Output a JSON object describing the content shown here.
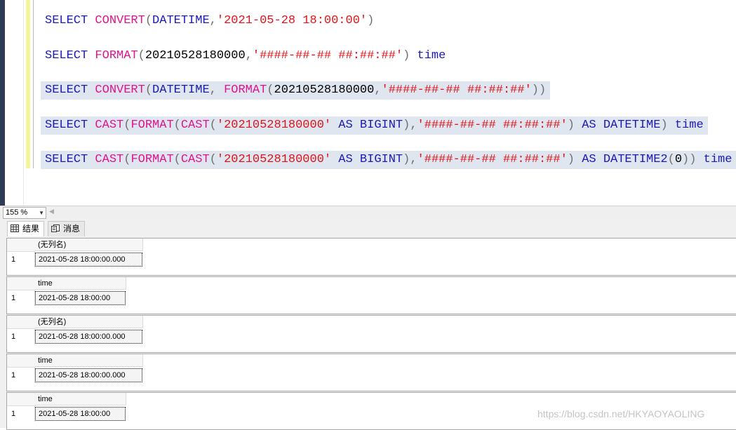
{
  "editor": {
    "lines": [
      [
        {
          "t": "SELECT ",
          "c": "kw"
        },
        {
          "t": "CONVERT",
          "c": "fn"
        },
        {
          "t": "(",
          "c": "pn"
        },
        {
          "t": "DATETIME",
          "c": "kw"
        },
        {
          "t": ",",
          "c": "pn"
        },
        {
          "t": "'2021-05-28 18:00:00'",
          "c": "str"
        },
        {
          "t": ")",
          "c": "pn"
        }
      ],
      [
        {
          "t": "SELECT ",
          "c": "kw"
        },
        {
          "t": "FORMAT",
          "c": "fn"
        },
        {
          "t": "(",
          "c": "pn"
        },
        {
          "t": "20210528180000",
          "c": "tx"
        },
        {
          "t": ",",
          "c": "pn"
        },
        {
          "t": "'####-##-## ##:##:##'",
          "c": "str"
        },
        {
          "t": ") ",
          "c": "pn"
        },
        {
          "t": "time",
          "c": "kw"
        }
      ],
      [
        {
          "t": "SELECT ",
          "c": "kw"
        },
        {
          "t": "CONVERT",
          "c": "fn"
        },
        {
          "t": "(",
          "c": "pn"
        },
        {
          "t": "DATETIME",
          "c": "kw"
        },
        {
          "t": ", ",
          "c": "pn"
        },
        {
          "t": "FORMAT",
          "c": "fn"
        },
        {
          "t": "(",
          "c": "pn"
        },
        {
          "t": "20210528180000",
          "c": "tx"
        },
        {
          "t": ",",
          "c": "pn"
        },
        {
          "t": "'####-##-## ##:##:##'",
          "c": "str"
        },
        {
          "t": "))",
          "c": "pn"
        }
      ],
      [
        {
          "t": "SELECT ",
          "c": "kw"
        },
        {
          "t": "CAST",
          "c": "fn"
        },
        {
          "t": "(",
          "c": "pn"
        },
        {
          "t": "FORMAT",
          "c": "fn"
        },
        {
          "t": "(",
          "c": "pn"
        },
        {
          "t": "CAST",
          "c": "fn"
        },
        {
          "t": "(",
          "c": "pn"
        },
        {
          "t": "'20210528180000'",
          "c": "str"
        },
        {
          "t": " AS ",
          "c": "kw"
        },
        {
          "t": "BIGINT",
          "c": "kw"
        },
        {
          "t": "),",
          "c": "pn"
        },
        {
          "t": "'####-##-## ##:##:##'",
          "c": "str"
        },
        {
          "t": ") ",
          "c": "pn"
        },
        {
          "t": "AS ",
          "c": "kw"
        },
        {
          "t": "DATETIME",
          "c": "kw"
        },
        {
          "t": ") ",
          "c": "pn"
        },
        {
          "t": "time",
          "c": "kw"
        }
      ],
      [
        {
          "t": "SELECT ",
          "c": "kw"
        },
        {
          "t": "CAST",
          "c": "fn"
        },
        {
          "t": "(",
          "c": "pn"
        },
        {
          "t": "FORMAT",
          "c": "fn"
        },
        {
          "t": "(",
          "c": "pn"
        },
        {
          "t": "CAST",
          "c": "fn"
        },
        {
          "t": "(",
          "c": "pn"
        },
        {
          "t": "'20210528180000'",
          "c": "str"
        },
        {
          "t": " AS ",
          "c": "kw"
        },
        {
          "t": "BIGINT",
          "c": "kw"
        },
        {
          "t": "),",
          "c": "pn"
        },
        {
          "t": "'####-##-## ##:##:##'",
          "c": "str"
        },
        {
          "t": ") ",
          "c": "pn"
        },
        {
          "t": "AS ",
          "c": "kw"
        },
        {
          "t": "DATETIME2",
          "c": "kw"
        },
        {
          "t": "(",
          "c": "pn"
        },
        {
          "t": "0",
          "c": "tx"
        },
        {
          "t": ")) ",
          "c": "pn"
        },
        {
          "t": "time",
          "c": "kw"
        }
      ]
    ],
    "selected_lines": [
      2,
      3,
      4
    ]
  },
  "zoom": {
    "value": "155 %"
  },
  "tabs": [
    {
      "label": "结果",
      "icon": "grid-icon",
      "active": true
    },
    {
      "label": "消息",
      "icon": "message-icon",
      "active": false
    }
  ],
  "results": [
    {
      "header": "(无列名)",
      "row_number": "1",
      "value": "2021-05-28 18:00:00.000"
    },
    {
      "header": "time",
      "row_number": "1",
      "value": "2021-05-28 18:00:00"
    },
    {
      "header": "(无列名)",
      "row_number": "1",
      "value": "2021-05-28 18:00:00.000"
    },
    {
      "header": "time",
      "row_number": "1",
      "value": "2021-05-28 18:00:00.000"
    },
    {
      "header": "time",
      "row_number": "1",
      "value": "2021-05-28 18:00:00"
    }
  ],
  "watermark": "https://blog.csdn.net/HKYAOYAOLING"
}
